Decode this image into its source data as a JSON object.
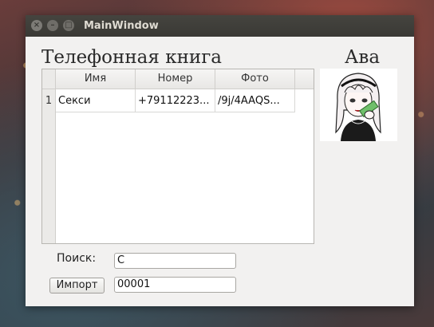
{
  "window": {
    "title": "MainWindow",
    "close_glyph": "×",
    "minimize_glyph": "–",
    "maximize_glyph": "□"
  },
  "phonebook": {
    "title": "Телефонная книга",
    "columns": [
      "Имя",
      "Номер",
      "Фото"
    ],
    "rows": [
      {
        "index": "1",
        "name": "Секси",
        "phone": "+79112223...",
        "photo": "/9j/4AAQS..."
      }
    ]
  },
  "avatar": {
    "title": "Ава",
    "image": "avatar-anime-girl-with-money"
  },
  "search": {
    "label": "Поиск:",
    "value": "С"
  },
  "import": {
    "button_label": "Импорт",
    "value": "00001"
  },
  "colors": {
    "window_bg": "#f2f1f0",
    "titlebar_bg": "#3f3e3a",
    "titlebar_text": "#dfdbd2"
  }
}
